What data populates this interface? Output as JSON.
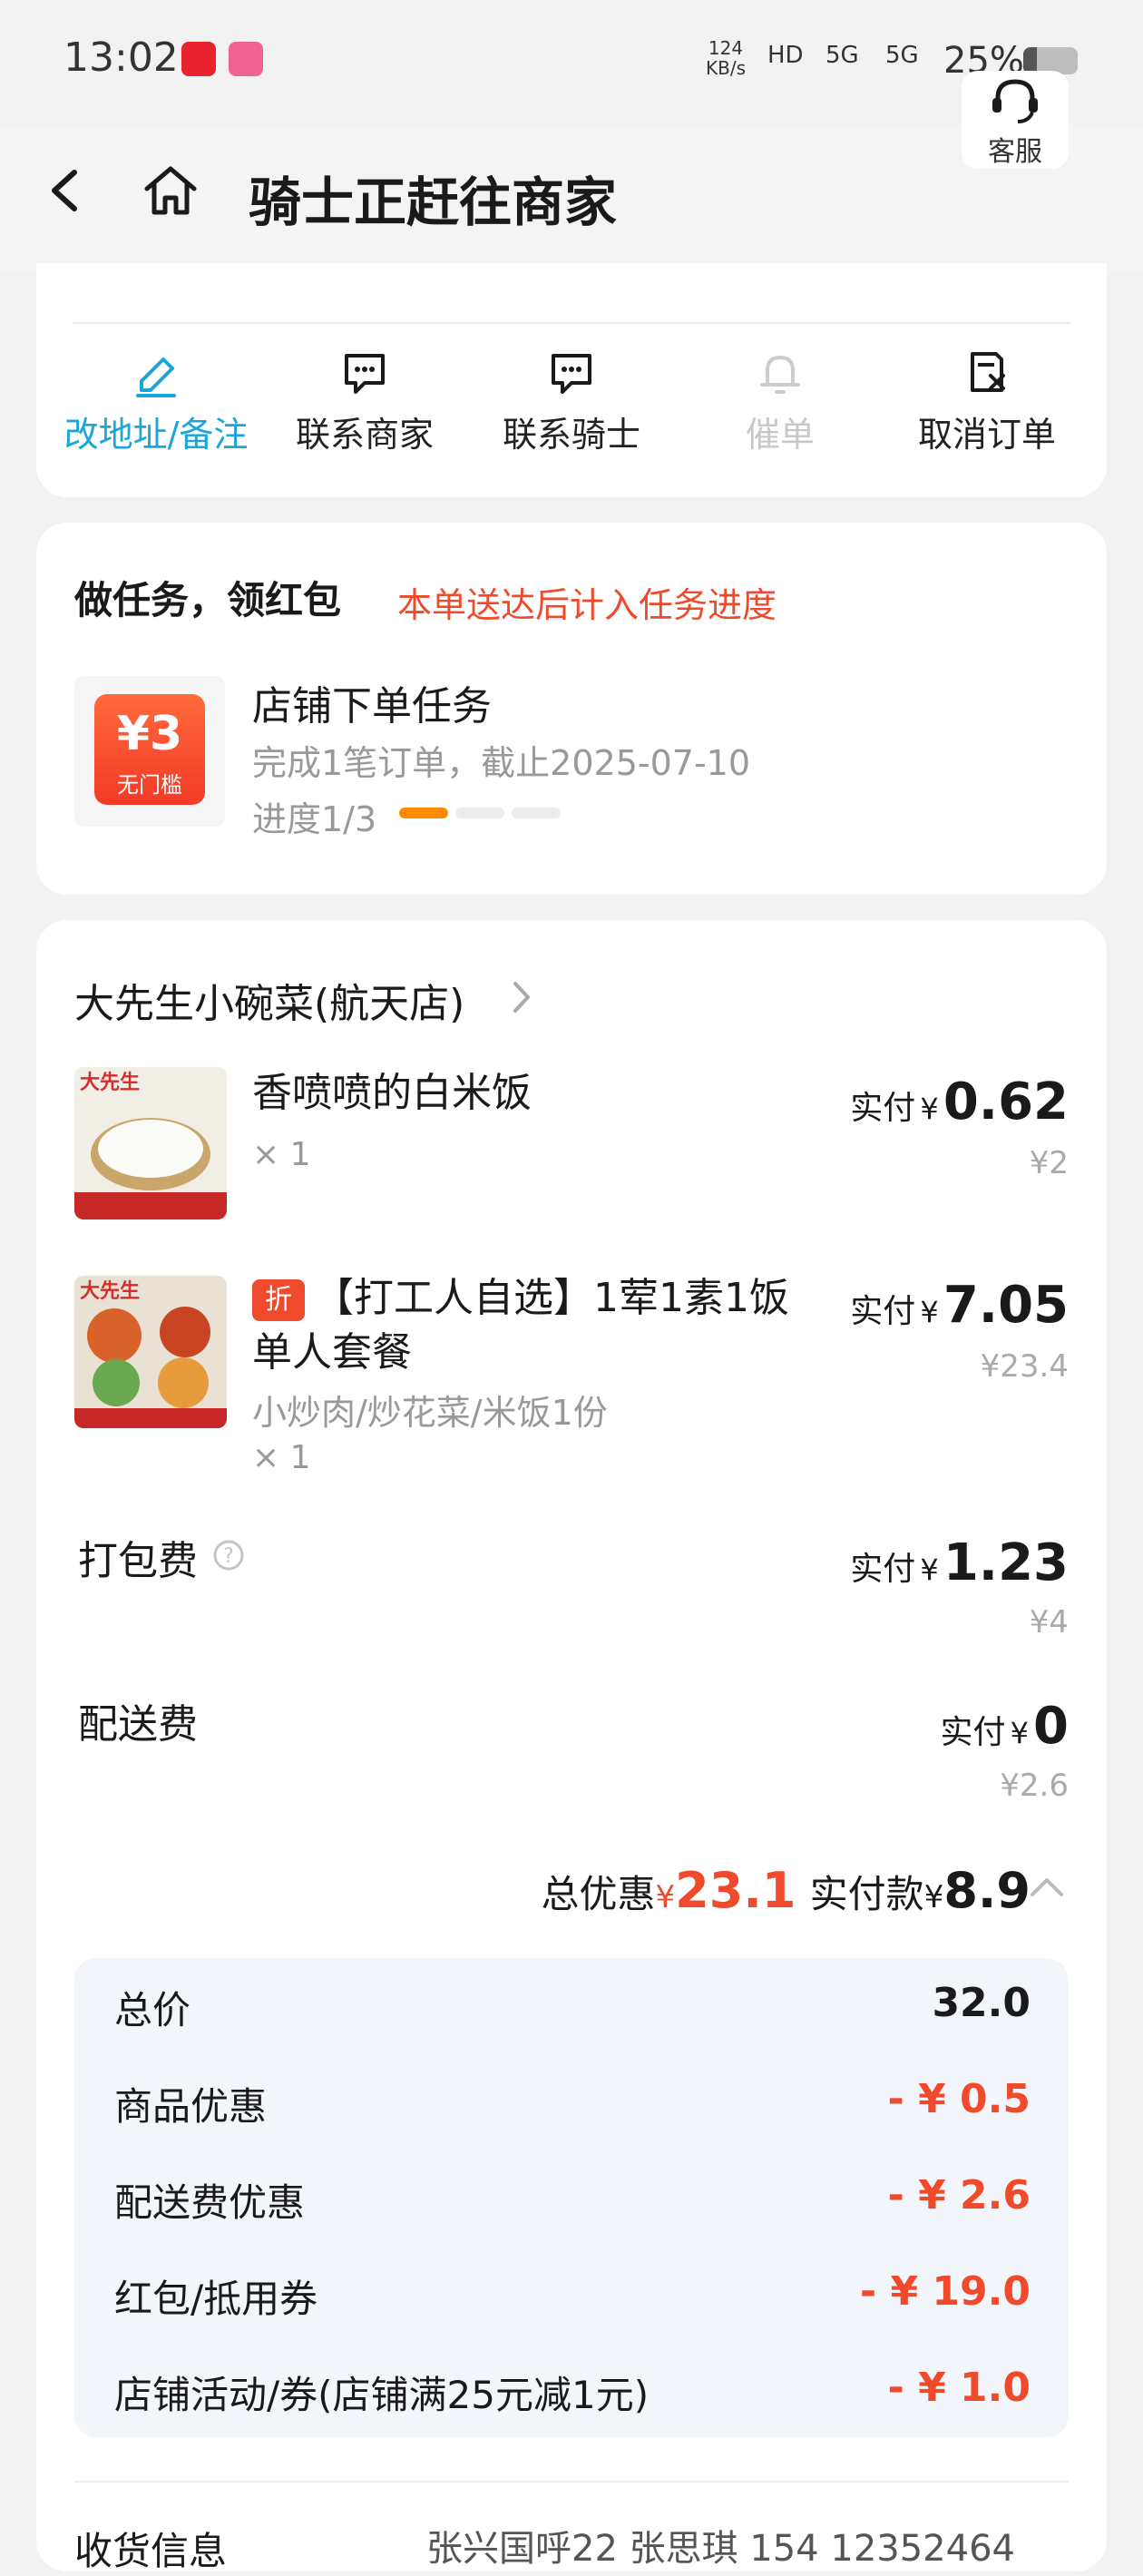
{
  "status_bar": {
    "time": "13:02",
    "net_speed_value": "124",
    "net_speed_unit": "KB/s",
    "hd": "HD",
    "signal1": "5G",
    "signal2": "5G",
    "battery": "25%",
    "battery_level": 0.25
  },
  "header": {
    "title": "骑士正赶往商家",
    "service_label": "客服"
  },
  "actions": [
    {
      "label": "改地址/备注",
      "icon": "edit-icon",
      "state": "active"
    },
    {
      "label": "联系商家",
      "icon": "chat-icon",
      "state": "normal"
    },
    {
      "label": "联系骑士",
      "icon": "chat-icon",
      "state": "normal"
    },
    {
      "label": "催单",
      "icon": "bell-icon",
      "state": "disabled"
    },
    {
      "label": "取消订单",
      "icon": "cancel-doc-icon",
      "state": "normal"
    }
  ],
  "task": {
    "title": "做任务，领红包",
    "subtitle": "本单送达后计入任务进度",
    "coupon_value": "¥3",
    "coupon_tag": "无门槛",
    "name": "店铺下单任务",
    "desc": "完成1笔订单，截止2025-07-10",
    "progress_text": "进度1/3",
    "progress_done": 1,
    "progress_total": 3
  },
  "store": {
    "name": "大先生小碗菜(航天店)"
  },
  "items": [
    {
      "name": "香喷喷的白米饭",
      "qty": "× 1",
      "pay_label": "实付",
      "currency": "¥",
      "pay": "0.62",
      "original": "¥2"
    },
    {
      "tag": "折",
      "name_line1": "【打工人自选】1荤1素1饭",
      "name_line2": "单人套餐",
      "spec": "小炒肉/炒花菜/米饭1份",
      "qty": "× 1",
      "pay_label": "实付",
      "currency": "¥",
      "pay": "7.05",
      "original": "¥23.4"
    }
  ],
  "fees": {
    "packing": {
      "label": "打包费",
      "pay_label": "实付",
      "currency": "¥",
      "pay": "1.23",
      "original": "¥4"
    },
    "delivery": {
      "label": "配送费",
      "pay_label": "实付",
      "currency": "¥",
      "pay": "0",
      "original": "¥2.6"
    }
  },
  "summary": {
    "discount_label": "总优惠",
    "currency": "¥",
    "discount": "23.1",
    "paid_label": "实付款",
    "paid": "8.9"
  },
  "breakdown": [
    {
      "label": "总价",
      "value": "32.0",
      "negative": false
    },
    {
      "label": "商品优惠",
      "value": "- ¥ 0.5",
      "negative": true
    },
    {
      "label": "配送费优惠",
      "value": "- ¥ 2.6",
      "negative": true
    },
    {
      "label": "红包/抵用券",
      "value": "- ¥ 19.0",
      "negative": true
    },
    {
      "label": "店铺活动/券(店铺满25元减1元)",
      "value": "- ¥ 1.0",
      "negative": true
    }
  ],
  "receiver": {
    "label": "收货信息",
    "info": "张兴国呼22 张思琪 154 12352464"
  },
  "colors": {
    "accent_blue": "#1aa7d8",
    "accent_red": "#f04a2d",
    "progress_orange": "#ff8a00"
  }
}
